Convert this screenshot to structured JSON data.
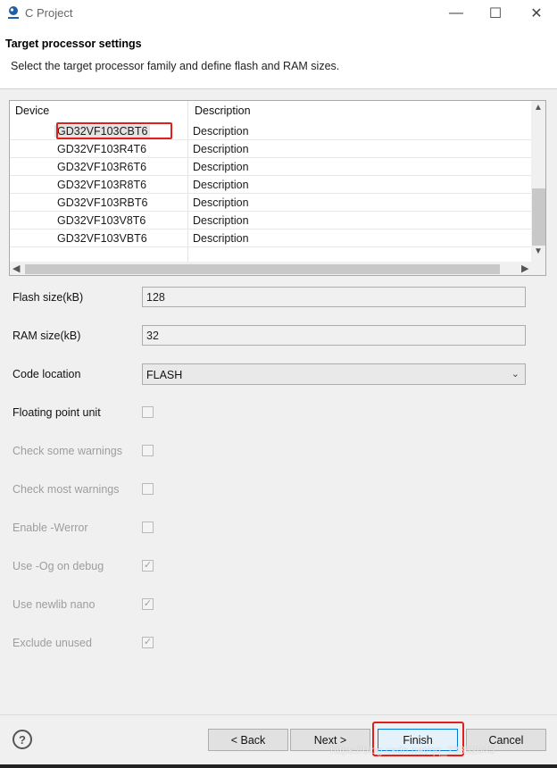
{
  "window": {
    "title": "C Project",
    "min": "—",
    "max": "☐",
    "close": "✕"
  },
  "header": {
    "title": "Target processor settings",
    "description": "Select the target processor family and define flash and RAM sizes."
  },
  "table": {
    "columns": [
      "Device",
      "Description"
    ],
    "rows": [
      {
        "device": "GD32VF103CBT6",
        "description": "Description"
      },
      {
        "device": "GD32VF103R4T6",
        "description": "Description"
      },
      {
        "device": "GD32VF103R6T6",
        "description": "Description"
      },
      {
        "device": "GD32VF103R8T6",
        "description": "Description"
      },
      {
        "device": "GD32VF103RBT6",
        "description": "Description"
      },
      {
        "device": "GD32VF103V8T6",
        "description": "Description"
      },
      {
        "device": "GD32VF103VBT6",
        "description": "Description"
      }
    ]
  },
  "form": {
    "flash_label": "Flash size(kB)",
    "flash_value": "128",
    "ram_label": "RAM size(kB)",
    "ram_value": "32",
    "code_location_label": "Code location",
    "code_location_value": "FLASH",
    "fpu_label": "Floating point unit",
    "check_some_label": "Check some warnings",
    "check_most_label": "Check most warnings",
    "werror_label": "Enable -Werror",
    "og_label": "Use -Og on debug",
    "newlib_label": "Use newlib nano",
    "exclude_label": "Exclude unused",
    "checked_mark": "✓"
  },
  "footer": {
    "help": "?",
    "back": "< Back",
    "next": "Next >",
    "finish": "Finish",
    "cancel": "Cancel",
    "watermark": "https://blog.csdn.net/qq_23852045"
  }
}
